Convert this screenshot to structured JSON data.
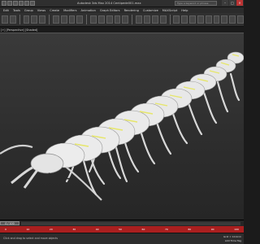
{
  "window": {
    "title": "Autodesk 3ds Max 2014    Centipede001.max",
    "search_placeholder": "Type a keyword or phrase",
    "minimize": "–",
    "maximize": "□",
    "close": "✕"
  },
  "menu": [
    "Edit",
    "Tools",
    "Group",
    "Views",
    "Create",
    "Modifiers",
    "Animation",
    "Graph Editors",
    "Rendering",
    "Customize",
    "MAXScript",
    "Help"
  ],
  "viewport": {
    "label": "[+] [Perspective] [Shaded]"
  },
  "timeline": {
    "slider_label": "0 / 100",
    "ticks": [
      "0",
      "10",
      "20",
      "30",
      "40",
      "50",
      "60",
      "70",
      "80",
      "90",
      "100"
    ]
  },
  "status": {
    "prompt": "Click and drag to select and move objects",
    "grid": "Grid = 10.0cm",
    "add_time_tag": "Add Time Tag"
  },
  "colors": {
    "track_red": "#aa1f1f",
    "viewport_bg": "#353535",
    "model_white": "#e8e8e8",
    "highlight_yellow": "#e6e66a"
  }
}
